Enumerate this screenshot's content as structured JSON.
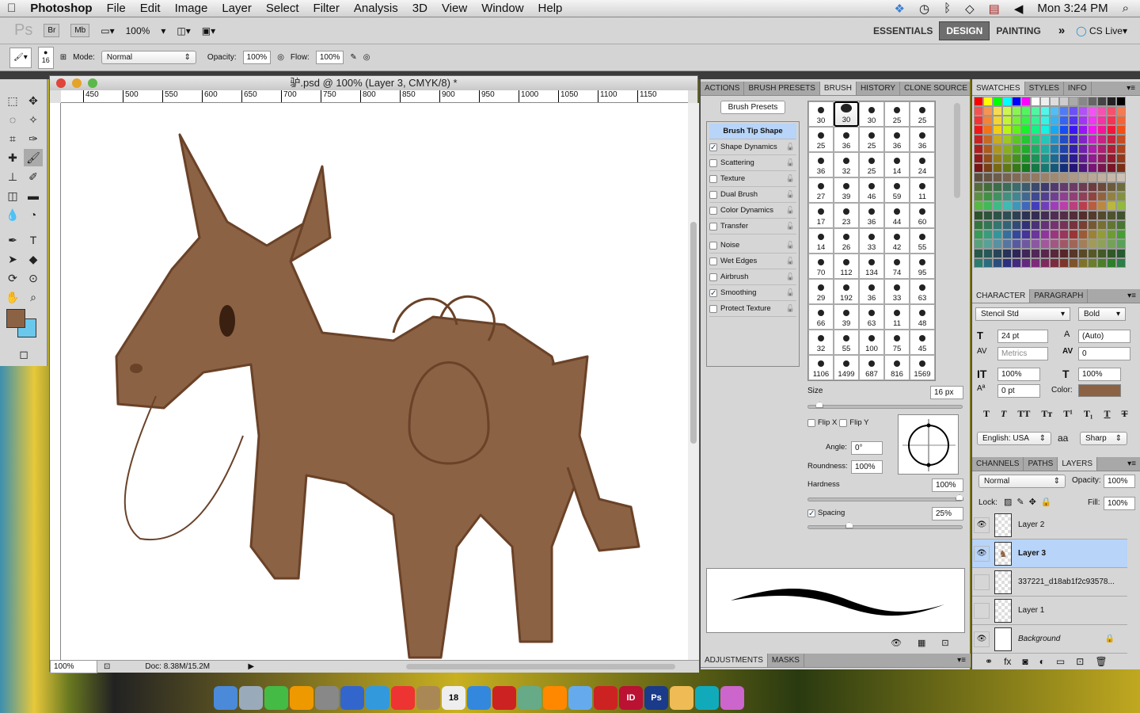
{
  "menubar": {
    "app": "Photoshop",
    "items": [
      "File",
      "Edit",
      "Image",
      "Layer",
      "Select",
      "Filter",
      "Analysis",
      "3D",
      "View",
      "Window",
      "Help"
    ],
    "clock": "Mon 3:24 PM"
  },
  "appbar": {
    "ps": "Ps",
    "br": "Br",
    "mb": "Mb",
    "zoom": "100%",
    "workspaces": [
      "ESSENTIALS",
      "DESIGN",
      "PAINTING"
    ],
    "active_workspace": "DESIGN",
    "more": "»",
    "cslive": "CS Live"
  },
  "options": {
    "brush_size": "16",
    "mode_label": "Mode:",
    "mode": "Normal",
    "opacity_label": "Opacity:",
    "opacity": "100%",
    "flow_label": "Flow:",
    "flow": "100%"
  },
  "document": {
    "title": "驴.psd @ 100% (Layer 3, CMYK/8) *",
    "ruler": [
      "450",
      "500",
      "550",
      "600",
      "650",
      "700",
      "750",
      "800",
      "850",
      "900",
      "950",
      "1000",
      "1050",
      "1100",
      "1150"
    ],
    "zoom": "100%",
    "doc_size": "Doc: 8.38M/15.2M",
    "drawing_color": "#8c6244"
  },
  "brush_panel": {
    "tabs": [
      "ACTIONS",
      "BRUSH PRESETS",
      "BRUSH",
      "HISTORY",
      "CLONE SOURCE"
    ],
    "active_tab": "BRUSH",
    "presets_button": "Brush Presets",
    "options": [
      {
        "label": "Brush Tip Shape",
        "header": true
      },
      {
        "label": "Shape Dynamics",
        "checked": true
      },
      {
        "label": "Scattering",
        "checked": false
      },
      {
        "label": "Texture",
        "checked": false
      },
      {
        "label": "Dual Brush",
        "checked": false
      },
      {
        "label": "Color Dynamics",
        "checked": false
      },
      {
        "label": "Transfer",
        "checked": false
      },
      {
        "label": "Noise",
        "checked": false
      },
      {
        "label": "Wet Edges",
        "checked": false
      },
      {
        "label": "Airbrush",
        "checked": false
      },
      {
        "label": "Smoothing",
        "checked": true
      },
      {
        "label": "Protect Texture",
        "checked": false
      }
    ],
    "tips": [
      [
        "30",
        "30",
        "30",
        "25",
        "25"
      ],
      [
        "25",
        "36",
        "25",
        "36",
        "36"
      ],
      [
        "36",
        "32",
        "25",
        "14",
        "24"
      ],
      [
        "27",
        "39",
        "46",
        "59",
        "11"
      ],
      [
        "17",
        "23",
        "36",
        "44",
        "60"
      ],
      [
        "14",
        "26",
        "33",
        "42",
        "55"
      ],
      [
        "70",
        "112",
        "134",
        "74",
        "95"
      ],
      [
        "29",
        "192",
        "36",
        "33",
        "63"
      ],
      [
        "66",
        "39",
        "63",
        "11",
        "48"
      ],
      [
        "32",
        "55",
        "100",
        "75",
        "45"
      ],
      [
        "1106",
        "1499",
        "687",
        "816",
        "1569"
      ]
    ],
    "size_label": "Size",
    "size": "16 px",
    "flipx": "Flip X",
    "flipy": "Flip Y",
    "angle_label": "Angle:",
    "angle": "0°",
    "roundness_label": "Roundness:",
    "roundness": "100%",
    "hardness_label": "Hardness",
    "hardness": "100%",
    "spacing_label": "Spacing",
    "spacing": "25%",
    "size_fraction": 0.05,
    "hardness_fraction": 1.0,
    "spacing_fraction": 0.25
  },
  "adjustments": {
    "tabs": [
      "ADJUSTMENTS",
      "MASKS"
    ]
  },
  "swatches": {
    "tabs": [
      "SWATCHES",
      "STYLES",
      "INFO"
    ]
  },
  "character": {
    "tabs": [
      "CHARACTER",
      "PARAGRAPH"
    ],
    "font": "Stencil Std",
    "style": "Bold",
    "size": "24 pt",
    "leading": "(Auto)",
    "kerning": "Metrics",
    "tracking": "0",
    "vscale": "100%",
    "hscale": "100%",
    "baseline": "0 pt",
    "color_label": "Color:",
    "color": "#8c6244",
    "language": "English: USA",
    "aa_icon": "aa",
    "antialias": "Sharp"
  },
  "layers": {
    "tabs": [
      "CHANNELS",
      "PATHS",
      "LAYERS"
    ],
    "blend": "Normal",
    "opacity_label": "Opacity:",
    "opacity": "100%",
    "lock_label": "Lock:",
    "fill_label": "Fill:",
    "fill": "100%",
    "items": [
      {
        "name": "Layer 2",
        "visible": true
      },
      {
        "name": "Layer 3",
        "visible": true,
        "active": true
      },
      {
        "name": "337221_d18ab1f2c93578...",
        "visible": false
      },
      {
        "name": "Layer 1",
        "visible": false
      },
      {
        "name": "Background",
        "visible": true,
        "locked": true
      }
    ]
  },
  "dock": {
    "apps": [
      "Finder",
      "Dashboard",
      "Numbers",
      "Pages",
      "Automator",
      "App Store",
      "Safari",
      "Chrome",
      "Address Book",
      "Calendar",
      "iTunes",
      "Photo Booth",
      "iPhoto",
      "VLC",
      "Preview",
      "Acrobat",
      "ID",
      "Ps",
      "Notes",
      "Skype",
      "Dashcode"
    ],
    "calendar_day": "18"
  }
}
